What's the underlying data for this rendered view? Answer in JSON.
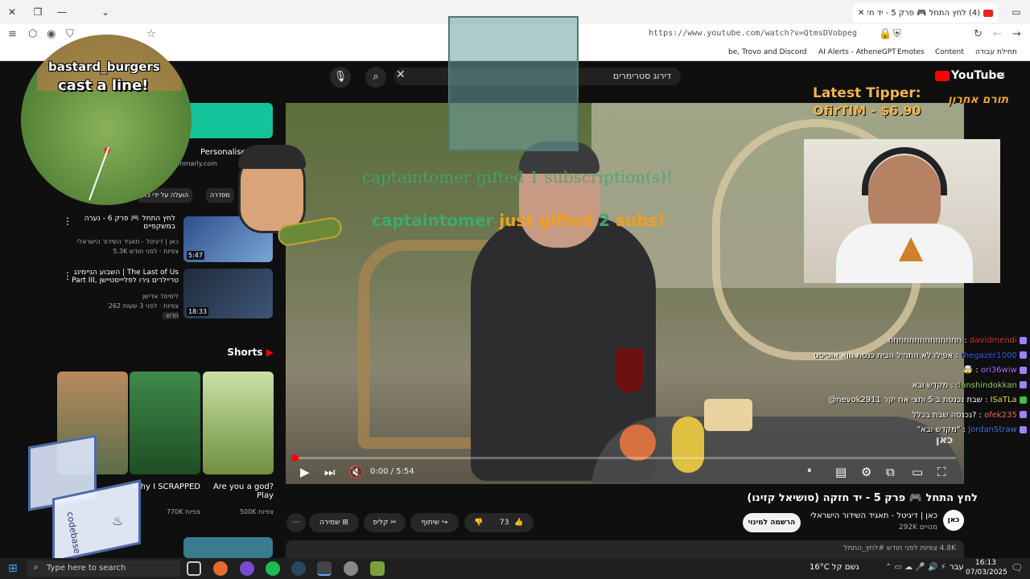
{
  "browser": {
    "tab_title": "(4) לחץ התחל 🎮 פרק 5 - יד חז…",
    "url": "https://www.youtube.com/watch?v=QtmsDVobpeg",
    "bookmarks": [
      "תחילת עבודה",
      "Content",
      "Emotes",
      "AI Alerts - AtheneGPT",
      "be, Trovo and Discord"
    ]
  },
  "youtube": {
    "search_text": "דירוג סטרימרים",
    "logo_text": "YouTube",
    "logo_region": "IL",
    "player": {
      "time": "0:00 / 5:54",
      "progress": 0,
      "watermark": "כאן"
    },
    "video": {
      "title": "לחץ התחל 🎮 פרק 5 - יד חזקה (סושיאל קזינו)",
      "channel": "כאן | דיגיטל - תאגיד השידור הישראלי",
      "subscribers": "292K מנויים",
      "subscribe_label": "הרשמה למינוי",
      "likes": "73",
      "share_label": "שיתוף",
      "clip_label": "קליפ",
      "save_label": "שמירה",
      "description": "4.8K צפיות  לפני חודש  #לחץ_התחל"
    },
    "sidebar": {
      "chips": [
        "מסדרה",
        "הועלה על ידי כאן"
      ],
      "ad": {
        "title": "Personalised AI",
        "domain": "grammarly.com"
      },
      "videos": [
        {
          "title": "לחץ התחל 🎮 פרק 6 - נערה במשקפיים",
          "channel": "כאן | דיגיטל - תאגיד השידור הישראלי",
          "meta": "5.3K צפיות · לפני חודש",
          "duration": "5:47"
        },
        {
          "title": "השבוע הגיימינג | The Last of Us Part III, טריילרים גירו לפליייסטיישן",
          "channel": "לימיסד אדישן",
          "meta": "262 צפיות · לפני 3 שעות",
          "badge": "חדש",
          "duration": "18:33"
        }
      ],
      "shorts_heading": "Shorts",
      "shorts": [
        {
          "title": "Are you a god? Play",
          "views": "500K צפיות"
        },
        {
          "title": "Why I SCRAPPED",
          "views": "770K צפיות"
        },
        {
          "title": "",
          "views": ""
        }
      ]
    }
  },
  "overlay": {
    "name": "bastard_burgers",
    "line": "cast a line!",
    "tipper_label": "Latest Tipper:",
    "tipper_value": "OfirTIM - $6.90",
    "donor_label": "תורם אחרון",
    "gift_line_1": "captaintomer gifted 1 subscription(s)!",
    "gift_line_2_user": "captaintomer",
    "gift_line_2_text": "just gifted",
    "gift_line_2_count": "2",
    "gift_line_2_suffix": "subs!",
    "codebase_label": "codebase",
    "chat": [
      {
        "user": "davidmendi",
        "msg": "חחחחחחחחחחחחחח"
      },
      {
        "user": "thegazer1000",
        "msg": "אפילו לא התחיל הבית כנסת הוא אוטיסט"
      },
      {
        "user": "ori36wiw",
        "msg": "🤯"
      },
      {
        "user": "danshindokkan",
        "msg": "מקדש ובא"
      },
      {
        "user": "ISaTLa",
        "msg": "@nevok2911 שבת נכנסת ב 5 ותצי אח יקר"
      },
      {
        "user": "ofek235",
        "msg": "נכנסה שבת בכלל?"
      },
      {
        "user": "JordanStraw",
        "msg": "\"מקדש ובא\""
      }
    ]
  },
  "taskbar": {
    "search_placeholder": "Type here to search",
    "weather": "16°C גשם קל",
    "lang": "עבר",
    "time": "16:13",
    "date": "07/03/2025"
  },
  "colors": {
    "youtube_red": "#ff0000",
    "tipper": "#f3b54a",
    "gift_green": "#3caa6e",
    "gift_orange": "#f0a020"
  }
}
